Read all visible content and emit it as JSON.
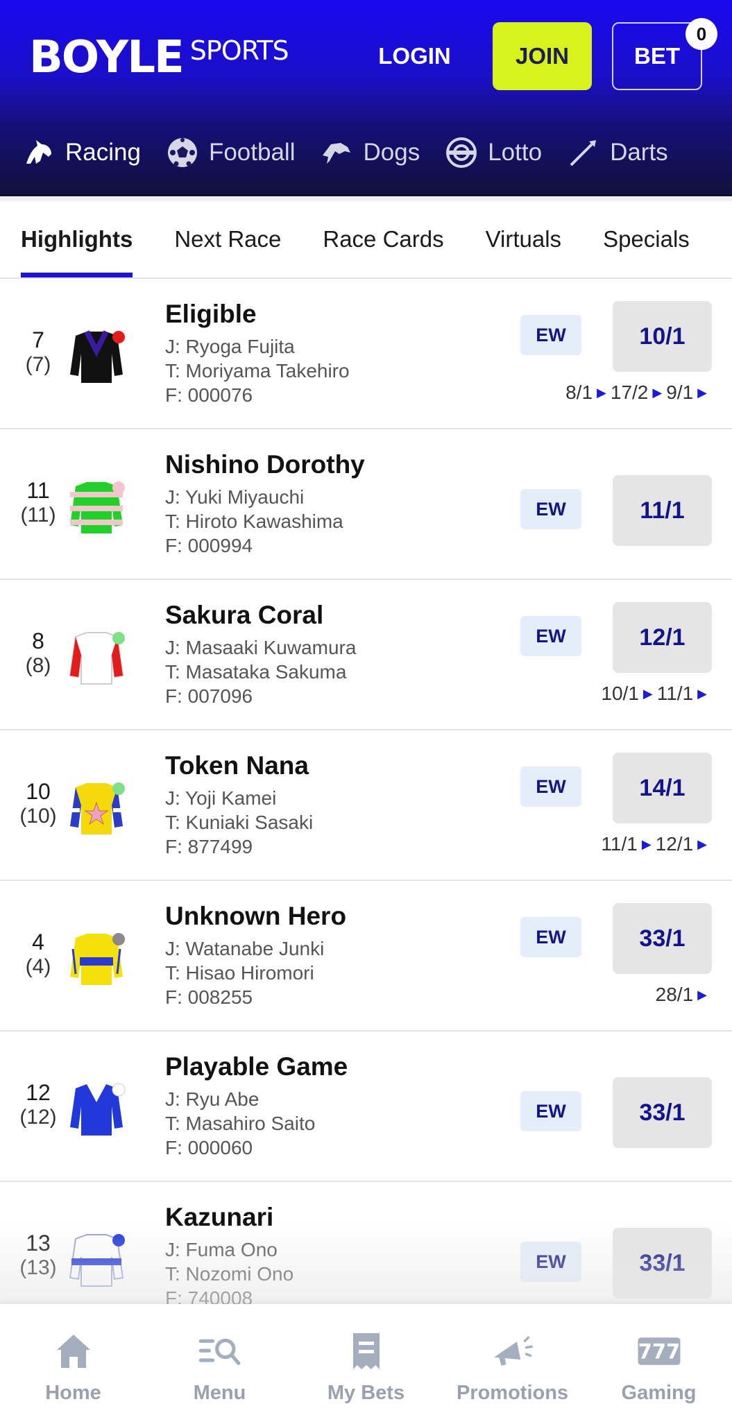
{
  "header": {
    "logo_main": "BOYLE",
    "logo_sub": "SPORTS",
    "login_label": "LOGIN",
    "join_label": "JOIN",
    "bet_label": "BET",
    "bet_count": "0",
    "accent_join": "#d8f21e",
    "brand_blue": "#1a08f0"
  },
  "sports_nav": [
    {
      "label": "Racing",
      "icon": "horse-head-icon"
    },
    {
      "label": "Football",
      "icon": "football-icon"
    },
    {
      "label": "Dogs",
      "icon": "greyhound-icon"
    },
    {
      "label": "Lotto",
      "icon": "lotto-ball-icon"
    },
    {
      "label": "Darts",
      "icon": "dart-icon"
    }
  ],
  "tabs": [
    "Highlights",
    "Next Race",
    "Race Cards",
    "Virtuals",
    "Specials"
  ],
  "ew_label": "EW",
  "runners": [
    {
      "num": "7",
      "draw": "(7)",
      "name": "Eligible",
      "jockey": "J: Ryoga Fujita",
      "trainer": "T: Moriyama Takehiro",
      "form": "F: 000076",
      "odds": "10/1",
      "history": [
        "8/1",
        "17/2",
        "9/1"
      ]
    },
    {
      "num": "11",
      "draw": "(11)",
      "name": "Nishino Dorothy",
      "jockey": "J: Yuki Miyauchi",
      "trainer": "T: Hiroto Kawashima",
      "form": "F: 000994",
      "odds": "11/1",
      "history": []
    },
    {
      "num": "8",
      "draw": "(8)",
      "name": "Sakura Coral",
      "jockey": "J: Masaaki Kuwamura",
      "trainer": "T: Masataka Sakuma",
      "form": "F: 007096",
      "odds": "12/1",
      "history": [
        "10/1",
        "11/1"
      ]
    },
    {
      "num": "10",
      "draw": "(10)",
      "name": "Token Nana",
      "jockey": "J: Yoji Kamei",
      "trainer": "T: Kuniaki Sasaki",
      "form": "F: 877499",
      "odds": "14/1",
      "history": [
        "11/1",
        "12/1"
      ]
    },
    {
      "num": "4",
      "draw": "(4)",
      "name": "Unknown Hero",
      "jockey": "J: Watanabe Junki",
      "trainer": "T: Hisao Hiromori",
      "form": "F: 008255",
      "odds": "33/1",
      "history": [
        "28/1"
      ]
    },
    {
      "num": "12",
      "draw": "(12)",
      "name": "Playable Game",
      "jockey": "J: Ryu Abe",
      "trainer": "T: Masahiro Saito",
      "form": "F: 000060",
      "odds": "33/1",
      "history": []
    },
    {
      "num": "13",
      "draw": "(13)",
      "name": "Kazunari",
      "jockey": "J: Fuma Ono",
      "trainer": "T: Nozomi Ono",
      "form": "F: 740008",
      "odds": "33/1",
      "history": []
    }
  ],
  "bottom_nav": [
    {
      "label": "Home",
      "icon": "home-icon"
    },
    {
      "label": "Menu",
      "icon": "menu-search-icon"
    },
    {
      "label": "My Bets",
      "icon": "bet-slip-icon"
    },
    {
      "label": "Promotions",
      "icon": "megaphone-icon"
    },
    {
      "label": "Gaming",
      "icon": "slot-777-icon"
    }
  ]
}
